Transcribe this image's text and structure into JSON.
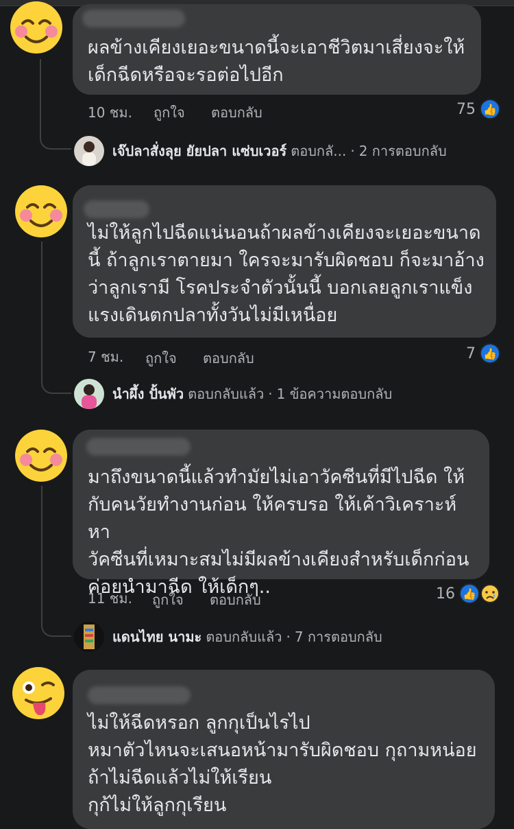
{
  "comments": [
    {
      "avatar": "smiling-face-emoji",
      "text": "ผลข้างเคียงเยอะขนาดนี้จะเอาชีวิตมาเสี่ยงจะให้\nเด็กฉีดหรือจะรอต่อไปอีก",
      "time": "10 ชม.",
      "like_label": "ถูกใจ",
      "reply_label": "ตอบกลับ",
      "reaction_count": "75",
      "reply_summary": {
        "name": "เจ๊ปลาสั่งลุย ยัยปลา แซ่บเวอร์",
        "action": "ตอบกลั...",
        "count": "2 การตอบกลับ"
      }
    },
    {
      "avatar": "smiling-face-emoji",
      "text": "ไม่ให้ลูกไปฉีดแน่นอนถ้าผลข้างเคียงจะเยอะขนาด\nนี้ ถ้าลูกเราตายมา ใครจะมารับผิดชอบ ก็จะมาอ้าง\nว่าลูกเรามี โรคประจำตัวนั้นนี้ บอกเลยลูกเราแข็ง\nแรงเดินตกปลาทั้งวันไม่มีเหนื่อย",
      "time": "7 ชม.",
      "like_label": "ถูกใจ",
      "reply_label": "ตอบกลับ",
      "reaction_count": "7",
      "reply_summary": {
        "name": "นำผึ้ง ปั้นพัว",
        "action": "ตอบกลับแล้ว",
        "count": "1 ข้อความตอบกลับ"
      }
    },
    {
      "avatar": "smiling-face-emoji",
      "text": "มาถึงขนาดนี้แล้วทำมัยไม่เอาวัคซีนที่มีไปฉีด ให้\nกับคนวัยทำงานก่อน ให้ครบรอ ให้เค้าวิเคราะห์หา\nวัคซีนที่เหมาะสมไม่มีผลข้างเคียงสำหรับเด็กก่อน\nค่อยนำมาฉีด ให้เด็กๆ..",
      "time": "11 ชม.",
      "like_label": "ถูกใจ",
      "reply_label": "ตอบกลับ",
      "reaction_count": "16",
      "reply_summary": {
        "name": "แดนไทย นามะ",
        "action": "ตอบกลับแล้ว",
        "count": "7 การตอบกลับ"
      }
    },
    {
      "avatar": "winking-tongue-emoji",
      "text": "ไม่ให้ฉีดหรอก ลูกกุเป็นไรไป\nหมาตัวไหนจะเสนอหน้ามารับผิดชอบ กุถามหน่อย\nถ้าไม่ฉีดแล้วไม่ให้เรียน\nกุก้ไม่ให้ลูกกุเรียน"
    }
  ],
  "colors": {
    "background": "#18191a",
    "bubble": "#3a3b3c",
    "like_blue": "#1b74e4"
  }
}
